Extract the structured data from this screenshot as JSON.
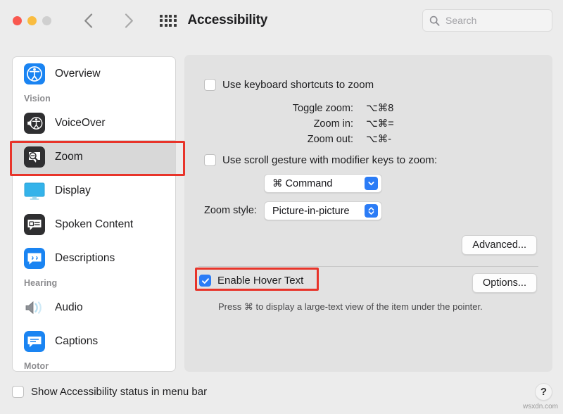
{
  "window": {
    "title": "Accessibility",
    "traffic_lights": [
      "close-red",
      "minimize-yellow",
      "zoom-gray"
    ],
    "back_label": "Back",
    "forward_label": "Forward",
    "grid_label": "Show All"
  },
  "search": {
    "placeholder": "Search",
    "value": "",
    "icon": "search-icon"
  },
  "sidebar": {
    "items": [
      {
        "type": "item",
        "label": "Overview",
        "icon": "accessibility-icon",
        "selected": false
      },
      {
        "type": "group",
        "label": "Vision"
      },
      {
        "type": "item",
        "label": "VoiceOver",
        "icon": "voiceover-icon",
        "selected": false
      },
      {
        "type": "item",
        "label": "Zoom",
        "icon": "zoom-icon",
        "selected": true
      },
      {
        "type": "item",
        "label": "Display",
        "icon": "display-icon",
        "selected": false
      },
      {
        "type": "item",
        "label": "Spoken Content",
        "icon": "spoken-content-icon",
        "selected": false
      },
      {
        "type": "item",
        "label": "Descriptions",
        "icon": "descriptions-icon",
        "selected": false
      },
      {
        "type": "group",
        "label": "Hearing"
      },
      {
        "type": "item",
        "label": "Audio",
        "icon": "audio-icon",
        "selected": false
      },
      {
        "type": "item",
        "label": "Captions",
        "icon": "captions-icon",
        "selected": false
      },
      {
        "type": "group",
        "label": "Motor"
      }
    ]
  },
  "main": {
    "keyboard_shortcuts": {
      "label": "Use keyboard shortcuts to zoom",
      "checked": false,
      "shortcuts": [
        {
          "name": "Toggle zoom:",
          "keys": "⌥⌘8"
        },
        {
          "name": "Zoom in:",
          "keys": "⌥⌘="
        },
        {
          "name": "Zoom out:",
          "keys": "⌥⌘-"
        }
      ]
    },
    "scroll_gesture": {
      "label": "Use scroll gesture with modifier keys to zoom:",
      "checked": false,
      "modifier_value": "⌘ Command",
      "modifier_arrow": "chevron-down-icon"
    },
    "zoom_style": {
      "label": "Zoom style:",
      "value": "Picture-in-picture",
      "arrow": "up-down-chevron-icon"
    },
    "advanced_button": "Advanced...",
    "hover_text": {
      "label": "Enable Hover Text",
      "checked": true,
      "options_button": "Options...",
      "hint": "Press ⌘ to display a large-text view of the item under the pointer."
    }
  },
  "bottom": {
    "status_checkbox_label": "Show Accessibility status in menu bar",
    "status_checkbox_checked": false,
    "help_label": "?",
    "watermark": "wsxdn.com"
  },
  "colors": {
    "accent": "#2b7cf6",
    "annotation": "#e8342a",
    "window_bg": "#ececec",
    "panel_bg": "#e2e2e2",
    "sidebar_bg": "#ffffff",
    "selected_row": "#d8d8d8"
  }
}
